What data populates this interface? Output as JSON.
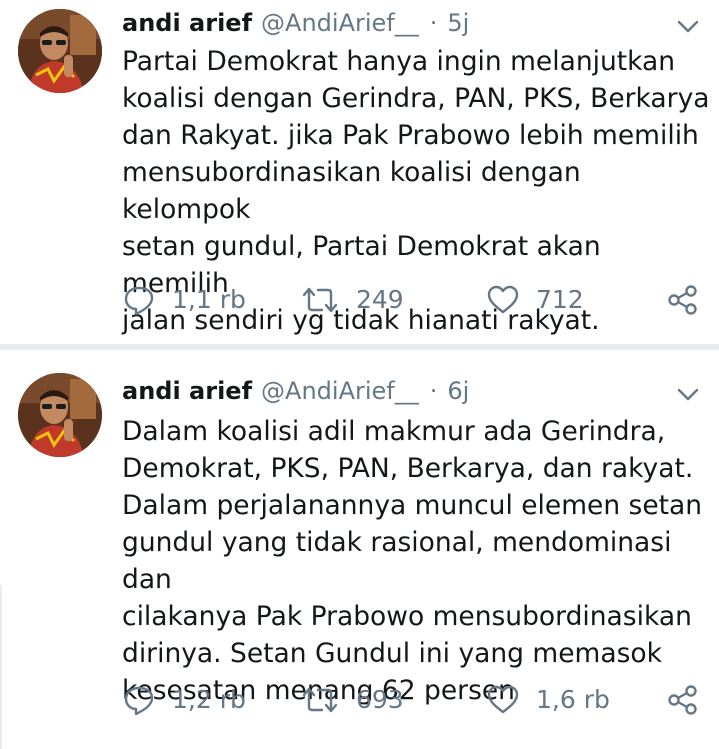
{
  "colors": {
    "text": "#14171a",
    "secondary": "#657786",
    "divider": "#e6ecf0"
  },
  "tweets": [
    {
      "display_name": "andi arief",
      "handle": "@AndiArief__",
      "separator": "·",
      "time": "5j",
      "text": "Partai Demokrat hanya ingin melanjutkan\nkoalisi dengan Gerindra, PAN, PKS, Berkarya\ndan Rakyat. jika Pak Prabowo lebih memilih\nmensubordinasikan koalisi dengan kelompok\nsetan gundul, Partai Demokrat akan memilih\njalan sendiri yg tidak hianati rakyat.",
      "replies": "1,1 rb",
      "retweets": "249",
      "likes": "712",
      "icons": [
        "reply-icon",
        "retweet-icon",
        "like-icon",
        "share-icon",
        "chevron-down-icon"
      ]
    },
    {
      "display_name": "andi arief",
      "handle": "@AndiArief__",
      "separator": "·",
      "time": "6j",
      "text": "Dalam koalisi adil makmur ada Gerindra,\nDemokrat, PKS, PAN, Berkarya, dan rakyat.\nDalam perjalanannya  muncul elemen setan\ngundul yang tidak rasional, mendominasi dan\ncilakanya Pak Prabowo mensubordinasikan\ndirinya. Setan Gundul ini yang memasok\nkesesatan menang 62 persen",
      "replies": "1,2 rb",
      "retweets": "693",
      "likes": "1,6 rb",
      "icons": [
        "reply-icon",
        "retweet-icon",
        "like-icon",
        "share-icon",
        "chevron-down-icon"
      ]
    }
  ]
}
